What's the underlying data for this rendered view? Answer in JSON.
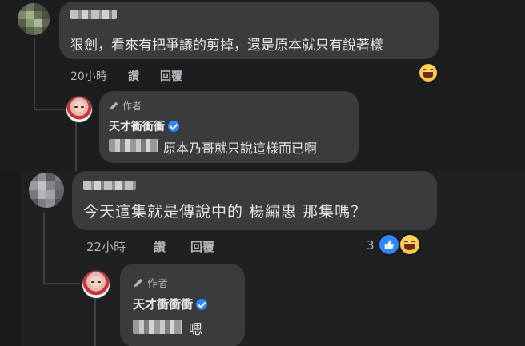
{
  "comments": [
    {
      "text": "狠劍，看來有把爭議的剪掉，還是原本就只有說著樣",
      "time": "20小時",
      "like_label": "讚",
      "reply_label": "回覆",
      "reaction": "haha-icon",
      "reply": {
        "author_badge": "作者",
        "author_name": "天才衝衝衝",
        "text": "原本乃哥就只說這樣而已啊",
        "verified": true
      }
    },
    {
      "text": "今天這集就是傳說中的 楊繡惠 那集嗎？",
      "time": "22小時",
      "like_label": "讚",
      "reply_label": "回覆",
      "reaction_count": "3",
      "reactions": [
        "like-icon",
        "haha-icon"
      ],
      "reply": {
        "author_badge": "作者",
        "author_name": "天才衝衝衝",
        "text": "嗯",
        "verified": true
      }
    }
  ],
  "colors": {
    "background": "#18191a",
    "bubble": "#3a3b3c",
    "text": "#e4e6eb",
    "meta": "#b0b3b8",
    "verified": "#2d88ff"
  }
}
